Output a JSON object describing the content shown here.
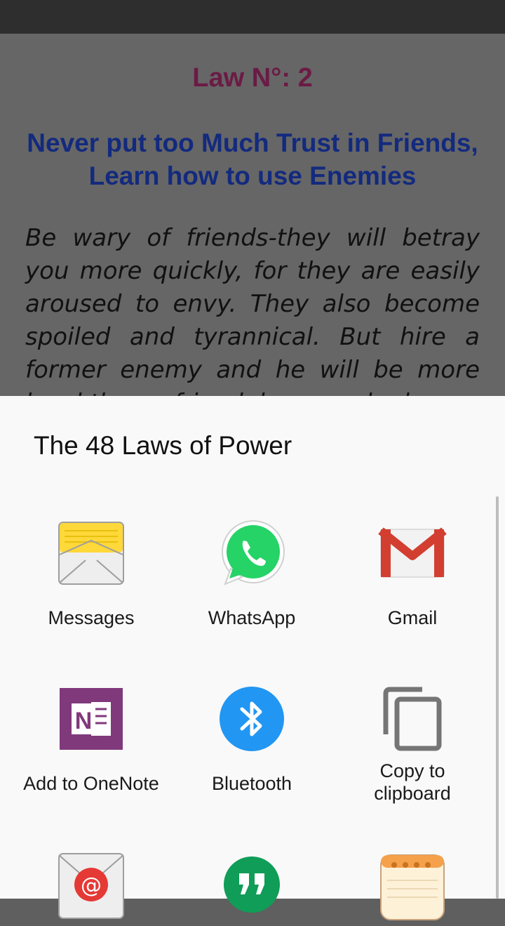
{
  "content": {
    "law_number": "Law N°: 2",
    "law_title": "Never put too Much Trust in Friends, Learn how to use Enemies",
    "law_body": "Be wary of friends-they will betray you more quickly, for they are easily aroused to envy. They also become spoiled and tyrannical. But hire a former enemy and he will be more loyal than a friend, because he has"
  },
  "share_sheet": {
    "title": "The 48 Laws of Power",
    "apps": [
      {
        "label": "Messages",
        "icon": "messages-icon"
      },
      {
        "label": "WhatsApp",
        "icon": "whatsapp-icon"
      },
      {
        "label": "Gmail",
        "icon": "gmail-icon"
      },
      {
        "label": "Add to OneNote",
        "icon": "onenote-icon"
      },
      {
        "label": "Bluetooth",
        "icon": "bluetooth-icon"
      },
      {
        "label": "Copy to\nclipboard",
        "icon": "copy-icon"
      },
      {
        "label": "",
        "icon": "email-icon"
      },
      {
        "label": "",
        "icon": "hangouts-icon"
      },
      {
        "label": "",
        "icon": "memo-icon"
      }
    ]
  },
  "colors": {
    "law_number": "#6b1b45",
    "law_title": "#132a7e",
    "sheet_bg": "#f9f9f9"
  }
}
